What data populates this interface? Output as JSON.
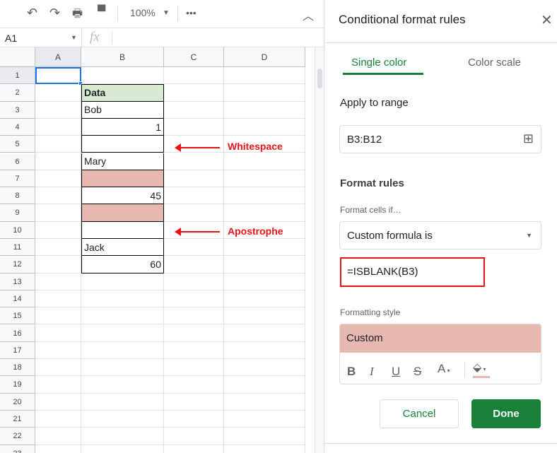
{
  "toolbar": {
    "zoom": "100%"
  },
  "formula_bar": {
    "cell_ref": "A1",
    "fx": "fx",
    "value": ""
  },
  "columns": [
    "A",
    "B",
    "C",
    "D"
  ],
  "rows": [
    "1",
    "2",
    "3",
    "4",
    "5",
    "6",
    "7",
    "8",
    "9",
    "10",
    "11",
    "12",
    "13",
    "14",
    "15",
    "16",
    "17",
    "18",
    "19",
    "20",
    "21",
    "22",
    "23"
  ],
  "cells": {
    "b2": "Data",
    "b3": "Bob",
    "b4": "1",
    "b5": "",
    "b6": "Mary",
    "b7": "",
    "b8": "45",
    "b9": "",
    "b10": "",
    "b11": "Jack",
    "b12": "60"
  },
  "annotations": {
    "whitespace": "Whitespace",
    "apostrophe": "Apostrophe"
  },
  "panel": {
    "title": "Conditional format rules",
    "tabs": [
      "Single color",
      "Color scale"
    ],
    "apply_label": "Apply to range",
    "range": "B3:B12",
    "format_rules_title": "Format rules",
    "condition_label": "Format cells if…",
    "condition": "Custom formula is",
    "formula": "=ISBLANK(B3)",
    "style_label": "Formatting style",
    "style_preview": "Custom",
    "cancel": "Cancel",
    "done": "Done"
  },
  "colors": {
    "header_fill": "#d9ead3",
    "highlight": "#e6b8af",
    "accent": "#188038",
    "red": "#e8141c"
  }
}
